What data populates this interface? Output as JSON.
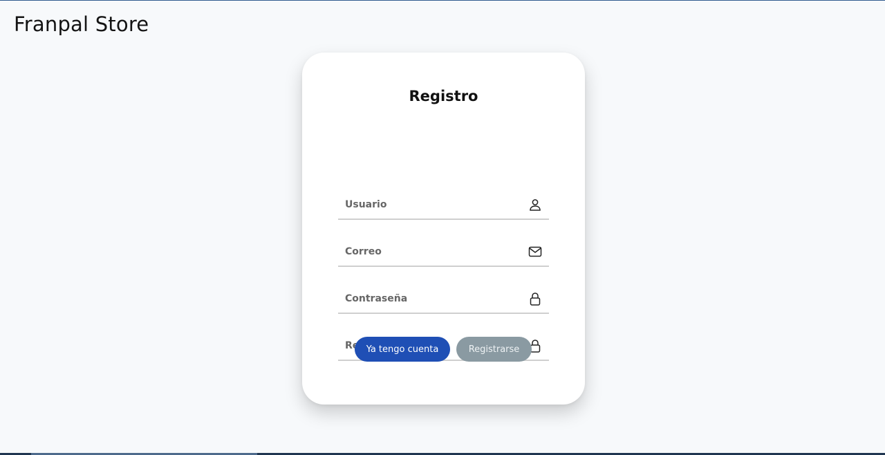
{
  "header": {
    "brand": "Franpal Store"
  },
  "form": {
    "title": "Registro",
    "fields": [
      {
        "placeholder": "Usuario",
        "value": "",
        "icon": "user-icon"
      },
      {
        "placeholder": "Correo",
        "value": "",
        "icon": "mail-icon"
      },
      {
        "placeholder": "Contraseña",
        "value": "",
        "icon": "lock-icon"
      },
      {
        "placeholder": "Repita Contraseña",
        "value": "",
        "icon": "lock-icon"
      }
    ],
    "login_label": "Ya tengo cuenta",
    "register_label": "Registrarse"
  },
  "colors": {
    "primary": "#1f4fb5",
    "secondary": "#8a9aa2",
    "background": "#f7f9fb"
  }
}
